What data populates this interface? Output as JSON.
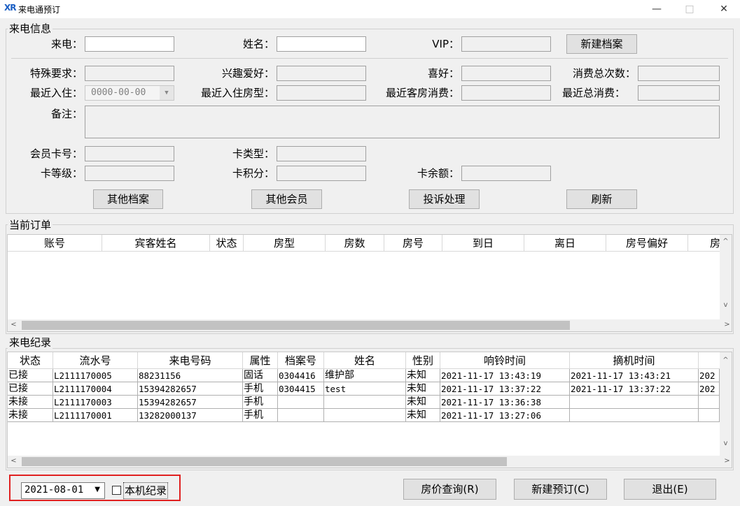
{
  "window": {
    "title": "来电通预订",
    "icon": "xr-logo-icon",
    "minimize": "—",
    "maximize": "□",
    "close": "✕"
  },
  "caller_info": {
    "group_label": "来电信息",
    "phone_label": "来电：",
    "name_label": "姓名：",
    "vip_label": "VIP：",
    "new_profile_button": "新建档案",
    "special_req_label": "特殊要求：",
    "hobby_label": "兴趣爱好：",
    "preference_label": "喜好：",
    "total_visits_label": "消费总次数：",
    "last_checkin_label": "最近入住：",
    "last_checkin_value": "0000-00-00",
    "last_room_type_label": "最近入住房型：",
    "last_room_spend_label": "最近客房消费：",
    "last_total_spend_label": "最近总消费：",
    "remarks_label": "备注：",
    "card_no_label": "会员卡号：",
    "card_type_label": "卡类型：",
    "card_level_label": "卡等级：",
    "card_points_label": "卡积分：",
    "card_balance_label": "卡余额：",
    "other_profiles_button": "其他档案",
    "other_members_button": "其他会员",
    "complaint_button": "投诉处理",
    "refresh_button": "刷新"
  },
  "current_orders": {
    "group_label": "当前订单",
    "columns": [
      "账号",
      "宾客姓名",
      "状态",
      "房型",
      "房数",
      "房号",
      "到日",
      "离日",
      "房号偏好",
      "房"
    ]
  },
  "call_records": {
    "group_label": "来电纪录",
    "columns": [
      "状态",
      "流水号",
      "来电号码",
      "属性",
      "档案号",
      "姓名",
      "性别",
      "响铃时间",
      "摘机时间"
    ],
    "rows": [
      [
        "已接",
        "L2111170005",
        "88231156",
        "固话",
        "0304416",
        "维护部",
        "未知",
        "2021-11-17 13:43:19",
        "2021-11-17 13:43:21",
        "202"
      ],
      [
        "已接",
        "L2111170004",
        "15394282657",
        "手机",
        "0304415",
        "test",
        "未知",
        "2021-11-17 13:37:22",
        "2021-11-17 13:37:22",
        "202"
      ],
      [
        "未接",
        "L2111170003",
        "15394282657",
        "手机",
        "",
        "",
        "未知",
        "2021-11-17 13:36:38",
        "",
        ""
      ],
      [
        "未接",
        "L2111170001",
        "13282000137",
        "手机",
        "",
        "",
        "未知",
        "2021-11-17 13:27:06",
        "",
        ""
      ]
    ]
  },
  "footer": {
    "date_value": "2021-08-01",
    "local_records_label": "本机纪录",
    "local_records_checked": false,
    "price_query_button": "房价查询(R)",
    "new_booking_button": "新建预订(C)",
    "exit_button": "退出(E)"
  }
}
